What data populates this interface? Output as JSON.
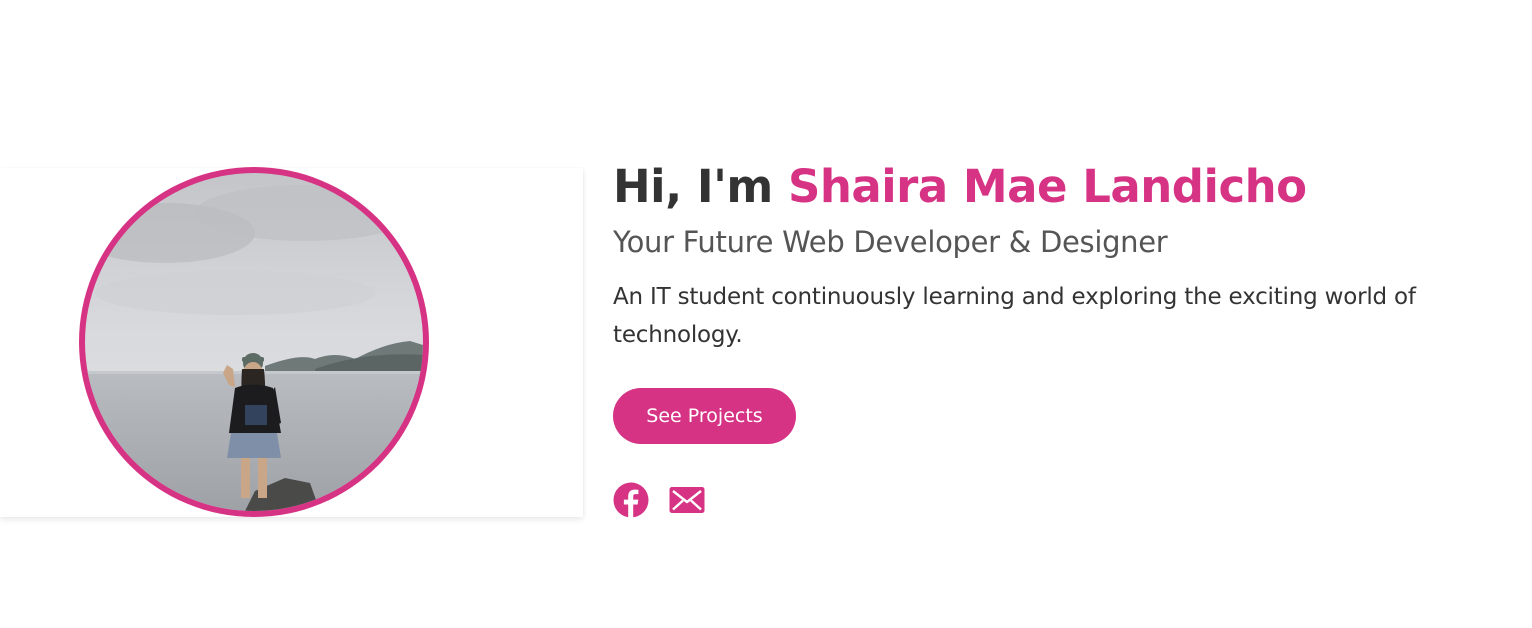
{
  "hero": {
    "greeting": "Hi, I'm ",
    "name": "Shaira Mae Landicho",
    "subtitle": "Your Future Web Developer & Designer",
    "bio": "An IT student continuously learning and exploring the exciting world of technology.",
    "cta_label": "See Projects",
    "accent_color": "#d63384",
    "text_color": "#333333"
  },
  "socials": [
    {
      "icon": "facebook-icon"
    },
    {
      "icon": "mail-icon"
    }
  ]
}
